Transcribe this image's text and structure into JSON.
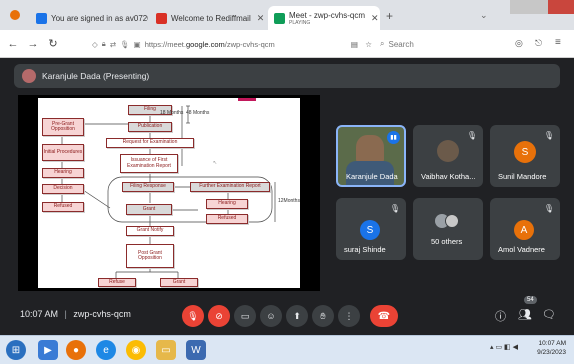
{
  "tabs": [
    {
      "title": "You are signed in as av07201(",
      "favicon_color": "#1a73e8"
    },
    {
      "title": "Welcome to Rediffmail",
      "favicon_color": "#d93025"
    },
    {
      "title": "Meet - zwp-cvhs-qcm",
      "subtitle": "PLAYING",
      "favicon_color": "#0f9d58"
    }
  ],
  "new_tab_label": "+",
  "address": {
    "prefix": "https://meet.",
    "domain": "google.com",
    "path": "/zwp-cvhs-qcm"
  },
  "search_placeholder": "Search",
  "presenter_banner": "Karanjule Dada (Presenting)",
  "chart_data": {
    "type": "flowchart",
    "nodes": [
      "Filing",
      "Publication",
      "Request for Examination",
      "Issuance of First Examination Report",
      "Filing Response",
      "Grant",
      "Further Examination Report",
      "Hearing",
      "Refused",
      "Pre-Grant Opposition",
      "Initial Procedures",
      "Hearing",
      "Decision",
      "Refused",
      "Grant Notify",
      "Post Grant Opposition",
      "Refuse",
      "Grant"
    ],
    "durations": [
      "18 Months",
      "48 Months",
      "12Months"
    ]
  },
  "participants": [
    {
      "name": "Karanjule Dada",
      "type": "video",
      "speaking": true
    },
    {
      "name": "Vaibhav Kotha...",
      "type": "photo",
      "muted": true
    },
    {
      "name": "Sunil Mandore",
      "initial": "S",
      "color": "#e8710a",
      "muted": true
    },
    {
      "name": "suraj Shinde",
      "initial": "S",
      "color": "#1a73e8",
      "muted": true
    },
    {
      "name": "50 others",
      "type": "others"
    },
    {
      "name": "Amol Vadnere",
      "initial": "A",
      "color": "#e8710a",
      "muted": true
    }
  ],
  "meeting": {
    "time": "10:07 AM",
    "separator": "|",
    "code": "zwp-cvhs-qcm",
    "participant_count": "54"
  },
  "clock": {
    "time": "10:07 AM",
    "date": "9/23/2023"
  }
}
